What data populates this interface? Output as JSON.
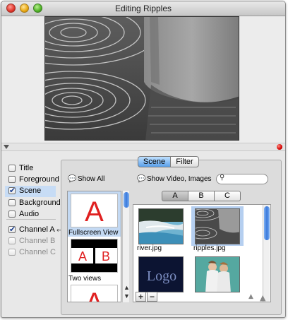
{
  "window": {
    "title": "Editing Ripples"
  },
  "layers": [
    {
      "label": "Title",
      "checked": false,
      "selected": false,
      "dim": false
    },
    {
      "label": "Foreground",
      "checked": false,
      "selected": false,
      "dim": false
    },
    {
      "label": "Scene",
      "checked": true,
      "selected": true,
      "dim": false
    },
    {
      "label": "Background",
      "checked": false,
      "selected": false,
      "dim": false
    },
    {
      "label": "Audio",
      "checked": false,
      "selected": false,
      "dim": false
    },
    {
      "label": "Channel A",
      "checked": true,
      "selected": false,
      "dim": false
    },
    {
      "label": "Channel B",
      "checked": false,
      "selected": false,
      "dim": true
    },
    {
      "label": "Channel C",
      "checked": false,
      "selected": false,
      "dim": true
    }
  ],
  "tabs": {
    "scene": "Scene",
    "filter": "Filter",
    "active": "Scene"
  },
  "panel": {
    "show_all": "Show All",
    "show_video": "Show Video, Images",
    "search_placeholder": ""
  },
  "channels": {
    "a": "A",
    "b": "B",
    "c": "C",
    "active": "A"
  },
  "scenes": [
    {
      "caption": "Fullscreen View",
      "thumb_text": "A"
    },
    {
      "caption": "Two views",
      "thumb_left": "A",
      "thumb_right": "B"
    },
    {
      "caption": "",
      "thumb_text": "A"
    }
  ],
  "media": [
    {
      "name": "river.jpg",
      "selected": false
    },
    {
      "name": "ripples.jpg",
      "selected": true
    },
    {
      "name": "",
      "logo_text": "Logo"
    },
    {
      "name": ""
    }
  ],
  "buttons": {
    "add": "+",
    "remove": "−"
  },
  "colors": {
    "accent": "#3a79dc",
    "selection": "#c3d9f3",
    "scene_red": "#e02020"
  }
}
